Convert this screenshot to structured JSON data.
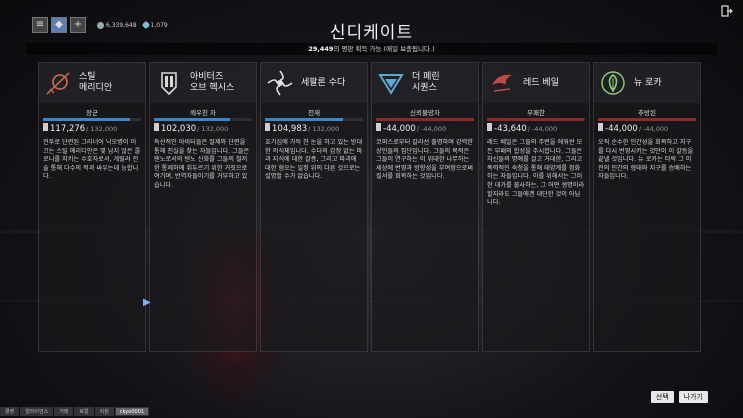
{
  "header": {
    "title": "신디케이트",
    "subtitle_count": "29,449",
    "subtitle_text": "의 평판 획득 가능 (매일 보충됩니다.)"
  },
  "topbar": {
    "credits": "6,339,648",
    "platinum": "1,079"
  },
  "syndicates": [
    {
      "name": "스틸\n메리디안",
      "rank": "장군",
      "standing": "117,276",
      "max": "/ 132,000",
      "progress": 0.888,
      "positive": true,
      "color": "#c0664a",
      "description": "전투로 단련된 그리너어 낙오병이 이끄는 스틸 메리디안은 몇 남지 않은 콜로니를 지키는 수호자로서, 게릴라 전술 통해 다수의 적과 싸우는데 능합니다."
    },
    {
      "name": "아비터즈\n오브 헥시스",
      "rank": "깨우친 자",
      "standing": "102,030",
      "max": "/ 132,000",
      "progress": 0.773,
      "positive": true,
      "color": "#d8d8d8",
      "description": "독선적인 아비터들은 절제와 단련을 통해 진실을 찾는 자들입니다. 그들은 텐노로서의 텐노 신화를 그들의 철저한 통제하에 휘두르기 위한 거짓으로 여기며, 반역자들이기를 거부하고 있습니다."
    },
    {
      "name": "세팔론 수다",
      "rank": "천재",
      "standing": "104,983",
      "max": "/ 132,000",
      "progress": 0.795,
      "positive": true,
      "color": "#e0e0e0",
      "description": "호기심에 가득 찬 눈을 하고 있는 방대한 의식체입니다. 수다의 감정 없는 파괴 지식에 대한 갈증, 그리고 파괴에 대한 혐오는 일정 위의 다른 것으로는 설명할 수가 없습니다."
    },
    {
      "name": "더 페린\n시퀀스",
      "rank": "신뢰불망자",
      "standing": "-44,000",
      "max": "/ -44,000",
      "progress": 1.0,
      "positive": false,
      "color": "#5aa9d6",
      "description": "코퍼스로부터 갈라선 출명하며 강력한 상인들의 집단입니다. 그들의 목적은 그들이 연구하는 이 위대한 나무하는 세상에 번영과 방향성을 부여함으로써 질서를 회복하는 것입니다."
    },
    {
      "name": "레드 베일",
      "rank": "부패한",
      "standing": "-43,640",
      "max": "/ -44,000",
      "progress": 0.992,
      "positive": false,
      "color": "#c04a4a",
      "description": "레드 베일은 그들의 주변을 에워싼 모든 부패의 합성을 주시합니다. 그들은 자신들의 명예를 걸고 거대한, 그리고 폭력적인 숙청을 통해 태양계를 정화하는 자들입니다. 이를 위해서는 그러한 대가를 불사하는, 그 어떤 생명이라 할지라도 그들에겐 대단한 것이 아닙니다."
    },
    {
      "name": "뉴 로카",
      "rank": "추방된",
      "standing": "-44,000",
      "max": "/ -44,000",
      "progress": 1.0,
      "positive": false,
      "color": "#8cd07a",
      "description": "오직 순수한 인간성을 회복하고 지구를 다시 번영시키는 것만이 이 갈등을 끝낼 것입니다. 뉴 로카는 타락 그 이전의 인간의 형태와 지구를 승배하는 자들입니다."
    }
  ],
  "chat_tabs": [
    "클랜",
    "얼라이언스",
    "거래",
    "로컬",
    "지원",
    "ckye0001"
  ],
  "buttons": {
    "select": "선택",
    "exit": "나가기"
  },
  "icons": [
    "menu-icon",
    "profile-icon",
    "plus-icon",
    "credits-icon",
    "platinum-icon",
    "quit-icon",
    "steel-meridian-icon",
    "arbiters-icon",
    "cephalon-suda-icon",
    "perrin-sequence-icon",
    "red-veil-icon",
    "new-loka-icon",
    "standing-icon",
    "cursor-icon"
  ]
}
